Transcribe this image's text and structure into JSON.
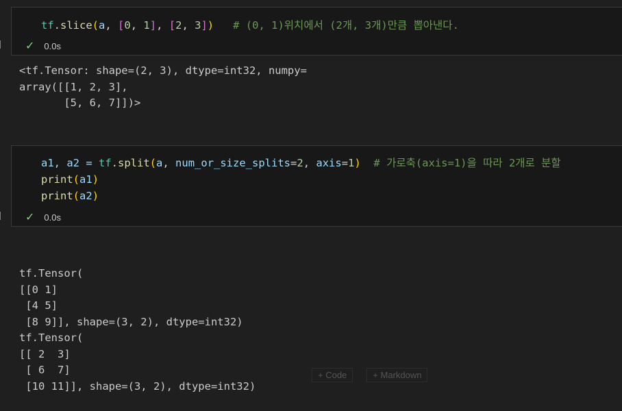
{
  "cells": [
    {
      "code": {
        "fn_mod": "tf",
        "fn_name": ".slice",
        "arg_a": "a",
        "b1": "[",
        "n0": "0",
        "n1": "1",
        "b2": "]",
        "b3": "[",
        "n2": "2",
        "n3": "3",
        "b4": "]",
        "comment": "# (0, 1)위치에서 (2개, 3개)만큼 뽑아낸다."
      },
      "status": {
        "time": "0.0s",
        "bracket": "]"
      },
      "output": [
        "<tf.Tensor: shape=(2, 3), dtype=int32, numpy=",
        "array([[1, 2, 3],",
        "       [5, 6, 7]])>"
      ]
    },
    {
      "code": {
        "lhs": "a1, a2 = ",
        "fn_mod": "tf",
        "fn_name": ".split",
        "arg_a": "a",
        "kw1": "num_or_size_splits",
        "v1": "2",
        "kw2": "axis",
        "v2": "1",
        "comment": "# 가로축(axis=1)을 따라 2개로 분할",
        "print": "print",
        "a1": "a1",
        "a2": "a2"
      },
      "status": {
        "time": "0.0s",
        "bracket": "]"
      },
      "output": [
        "tf.Tensor(",
        "[[0 1]",
        " [4 5]",
        " [8 9]], shape=(3, 2), dtype=int32)",
        "tf.Tensor(",
        "[[ 2  3]",
        " [ 6  7]",
        " [10 11]], shape=(3, 2), dtype=int32)"
      ]
    }
  ],
  "add_bar": {
    "code": "+ Code",
    "markdown": "+ Markdown"
  }
}
